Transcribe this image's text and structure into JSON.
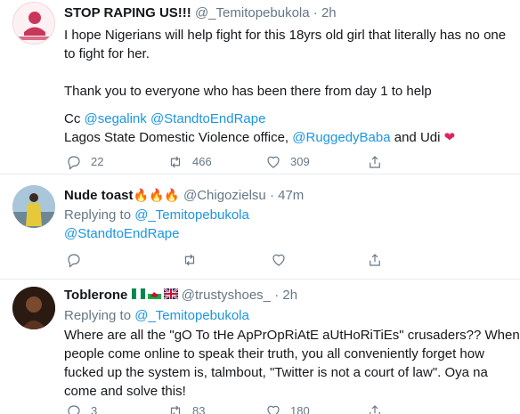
{
  "tweets": [
    {
      "name": "STOP RAPING US!!!",
      "handle": "@_Temitopebukola",
      "sep": "·",
      "time": "2h",
      "line1": "I hope Nigerians will help fight for this 18yrs old girl that literally has no one",
      "line2": "to fight for her.",
      "line3": "Thank you to everyone who has been there from day 1 to help",
      "cc": "Cc",
      "mention1": "@segalink",
      "mention2": "@StandtoEndRape",
      "line5_pre": "Lagos State Domestic Violence office,",
      "mention3": "@RuggedyBaba",
      "line5_post": "and Udi",
      "heart": "❤",
      "avatar_text": "#TeamTopeJustice",
      "replies": "22",
      "retweets": "466",
      "likes": "309"
    },
    {
      "name": "Nude toast",
      "name_emojis": "🔥🔥🔥",
      "handle": "@Chigozielsu",
      "sep": "·",
      "time": "47m",
      "replying_label": "Replying to",
      "replying_to": "@_Temitopebukola",
      "body": "@StandtoEndRape"
    },
    {
      "name": "Toblerone",
      "handle": "@trustyshoes_",
      "sep": "·",
      "time": "2h",
      "replying_label": "Replying to",
      "replying_to": "@_Temitopebukola",
      "line1": "Where are all the \"gO To tHe ApPrOpRiAtE aUtHoRiTiEs\" crusaders?? When",
      "line2": "people come online to speak their truth, you all conveniently forget how",
      "line3": "fucked up the system is, talmbout, \"Twitter is not a court of law\". Oya na",
      "line4": "come and solve this!",
      "replies": "3",
      "retweets": "83",
      "likes": "180"
    }
  ],
  "colors": {
    "link": "#1b95e0",
    "muted": "#657786",
    "text": "#14171a",
    "heart": "#e0245e",
    "divider": "#e6ecf0"
  }
}
